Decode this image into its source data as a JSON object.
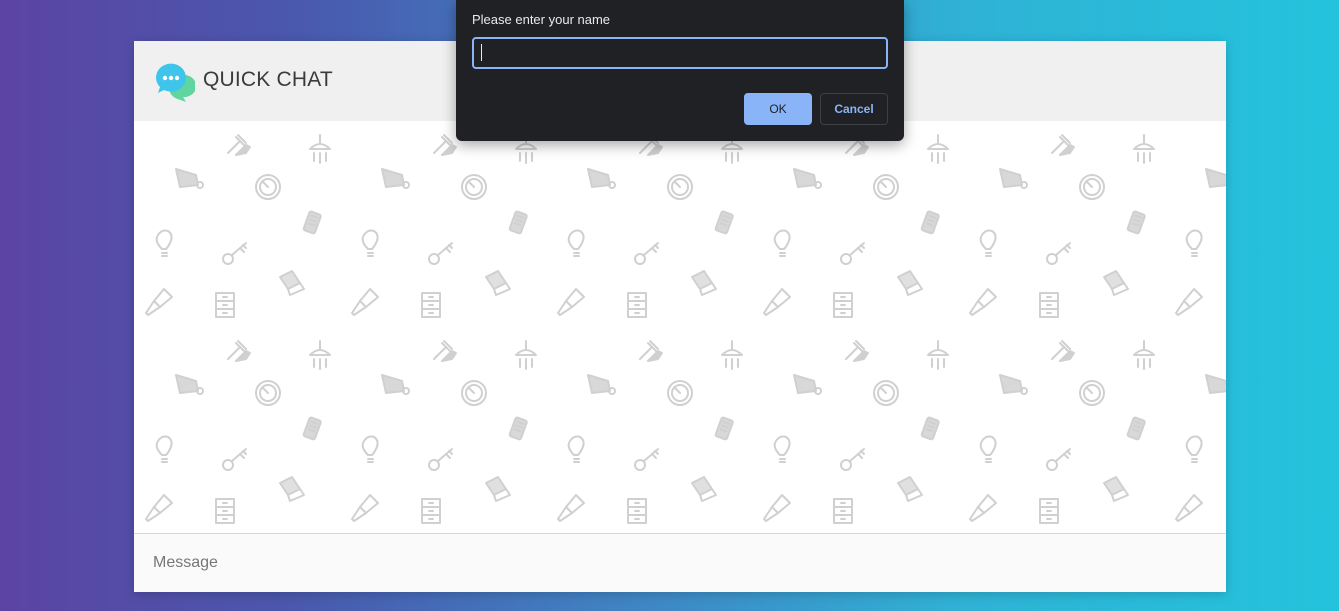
{
  "app": {
    "title": "QUICK CHAT",
    "logo_icon": "chat-bubbles-icon",
    "background_pattern_icons": [
      "garden-tools-icon",
      "shower-icon",
      "bathtub-icon",
      "gauge-icon",
      "phone-icon",
      "lightbulb-icon",
      "key-icon",
      "paint-roller-icon",
      "dresser-icon",
      "paintbrush-icon"
    ]
  },
  "composer": {
    "placeholder": "Message",
    "value": ""
  },
  "dialog": {
    "message": "Please enter your name",
    "input_value": "",
    "ok_label": "OK",
    "cancel_label": "Cancel"
  },
  "colors": {
    "gradient_start": "#5b44a3",
    "gradient_end": "#24c3dd",
    "dialog_bg": "#202124",
    "dialog_accent": "#8ab4f8",
    "header_bg": "#f0f0f0",
    "pattern_icon": "#d0d0d0"
  }
}
